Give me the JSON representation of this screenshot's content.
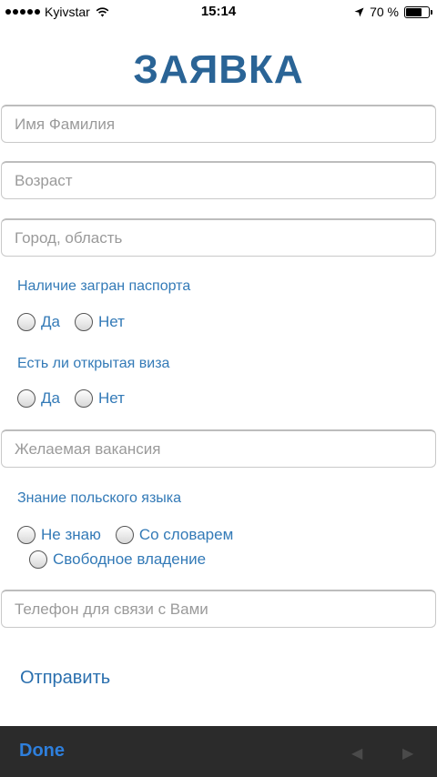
{
  "status_bar": {
    "carrier": "Kyivstar",
    "time": "15:14",
    "battery_percent": "70 %",
    "battery_level": 0.7
  },
  "form": {
    "title": "ЗАЯВКА",
    "name_placeholder": "Имя Фамилия",
    "age_placeholder": "Возраст",
    "city_placeholder": "Город, область",
    "passport_label": "Наличие загран паспорта",
    "passport_options": [
      "Да",
      "Нет"
    ],
    "visa_label": "Есть ли открытая виза",
    "visa_options": [
      "Да",
      "Нет"
    ],
    "vacancy_placeholder": "Желаемая вакансия",
    "polish_label": "Знание польского языка",
    "polish_options": [
      "Не знаю",
      "Со словарем",
      "Свободное владение"
    ],
    "phone_placeholder": "Телефон для связи с Вами",
    "submit_label": "Отправить"
  },
  "keyboard_toolbar": {
    "done_label": "Done",
    "prev_icon": "left-arrow-icon",
    "next_icon": "right-arrow-icon"
  },
  "colors": {
    "title": "#2a6496",
    "label": "#337ab7",
    "done": "#2e7fdc",
    "toolbar_bg": "#2b2b2b"
  }
}
